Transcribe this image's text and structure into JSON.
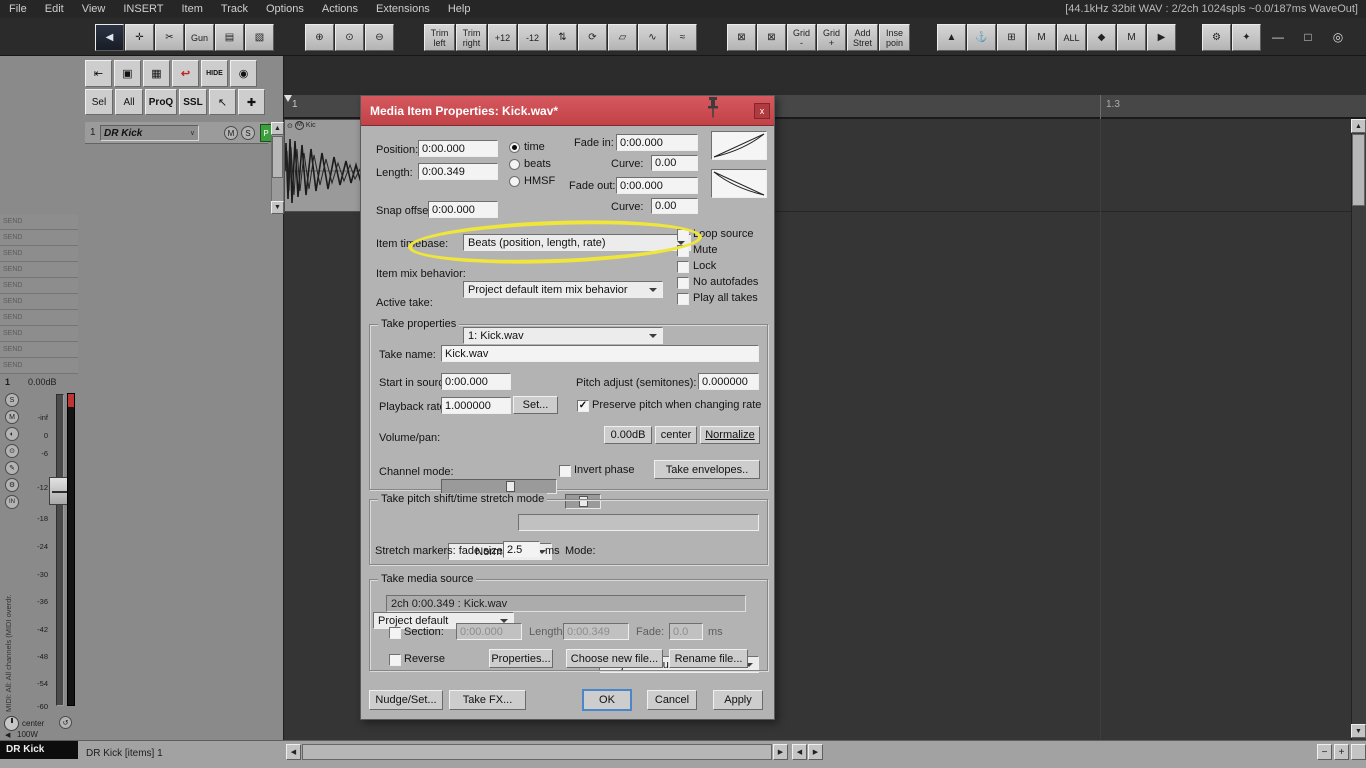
{
  "window": {
    "menu_items": [
      "File",
      "Edit",
      "View",
      "INSERT",
      "Item",
      "Track",
      "Options",
      "Actions",
      "Extensions",
      "Help"
    ],
    "audio_status": "[44.1kHz 32bit WAV : 2/2ch 1024spls ~0.0/187ms WaveOut]",
    "minimize": "—",
    "maximize": "□",
    "power": "◎"
  },
  "toolbar": {
    "g1": [
      "◀",
      "✛",
      "✂",
      "Gun",
      "▤",
      "▧"
    ],
    "g2": [
      "⊕",
      "⊙",
      "⊖"
    ],
    "g3": [
      "Trim\nleft",
      "Trim\nright",
      "+12",
      "-12",
      "⇅",
      "⟳",
      "▱",
      "∿",
      "≈"
    ],
    "g4": [
      "⊠",
      "⊠",
      "Grid\n-",
      "Grid\n+",
      "Add\nStret",
      "Inse\npoin"
    ],
    "g5": [
      "▲",
      "⚓",
      "⊞",
      "M",
      "ALL",
      "◆",
      "M",
      "▶"
    ],
    "g6": [
      "⚙",
      "✦"
    ]
  },
  "left_toolbar": {
    "row1": [
      "⇤",
      "▣",
      "▦",
      "↩",
      "HIDE",
      "◉"
    ],
    "row2": [
      "Sel",
      "All",
      "ProQ",
      "SSL",
      "↖",
      "✚"
    ]
  },
  "track": {
    "number": "1",
    "name": "DR Kick",
    "mute": "M",
    "solo": "S",
    "rec": "P"
  },
  "sends": [
    "SEND",
    "SEND",
    "SEND",
    "SEND",
    "SEND",
    "SEND",
    "SEND",
    "SEND",
    "SEND",
    "SEND"
  ],
  "mixer": {
    "number": "1",
    "volume": "0.00dB",
    "scale": [
      "-inf",
      "0",
      "-6",
      "-12",
      "-18",
      "-24",
      "-30",
      "-36",
      "-42",
      "-48",
      "-54",
      "-60"
    ],
    "side_buttons": [
      "S",
      "M",
      "◐",
      "⊙",
      "✎",
      "⚙",
      "IN"
    ],
    "vertical_label": "MIDI: All: All channels (MIDI overdr.",
    "pan": "center",
    "width": "100W",
    "label": "DR Kick"
  },
  "timeline": {
    "bar_start": "1",
    "bar_mid": "1.3",
    "item_label": "Kic"
  },
  "status": {
    "info": "DR Kick [items] 1"
  },
  "dialog": {
    "title": "Media Item Properties:  Kick.wav*",
    "close": "x",
    "position_label": "Position:",
    "position": "0:00.000",
    "length_label": "Length:",
    "length": "0:00.349",
    "fmt_time": "time",
    "fmt_beats": "beats",
    "fmt_hmsf": "HMSF",
    "fmt": {
      "time": true,
      "beats": false,
      "hmsf": false
    },
    "fade_in_label": "Fade in:",
    "fade_in": "0:00.000",
    "curve_label": "Curve:",
    "curve_in": "0.00",
    "fade_out_label": "Fade out:",
    "fade_out": "0:00.000",
    "curve_out": "0.00",
    "snap_label": "Snap offset:",
    "snap": "0:00.000",
    "timebase_label": "Item timebase:",
    "timebase": "Beats (position, length, rate)",
    "mix_label": "Item mix behavior:",
    "mix": "Project default item mix behavior",
    "take_label": "Active take:",
    "take": "1: Kick.wav",
    "loop_source": "Loop source",
    "mute": "Mute",
    "lock": "Lock",
    "no_autofades": "No autofades",
    "play_all_takes": "Play all takes",
    "checks": {
      "loop_source": false,
      "mute": false,
      "lock": false,
      "no_autofades": false,
      "play_all_takes": false,
      "preserve": true,
      "invert": false,
      "section": false,
      "reverse": false
    },
    "tp": {
      "group": "Take properties",
      "take_name_label": "Take name:",
      "take_name": "Kick.wav",
      "start_label": "Start in source:",
      "start": "0:00.000",
      "pitch_label": "Pitch adjust (semitones):",
      "pitch": "0.000000",
      "rate_label": "Playback rate:",
      "rate": "1.000000",
      "set": "Set...",
      "preserve": "Preserve pitch when changing rate",
      "volpan_label": "Volume/pan:",
      "db": "0.00dB",
      "pan": "center",
      "normalize": "Normalize",
      "chan_label": "Channel mode:",
      "chan": "Normal",
      "invert": "Invert phase",
      "envelopes": "Take envelopes.."
    },
    "ps": {
      "group": "Take pitch shift/time stretch mode",
      "mode": "Project default",
      "stretch_label": "Stretch markers: fade size:",
      "fade_size": "2.5",
      "ms": "ms",
      "mode_label": "Mode:",
      "stretch_mode": "Project default"
    },
    "ms": {
      "group": "Take media source",
      "source": "2ch 0:00.349 : Kick.wav",
      "section": "Section:",
      "sec_start": "0:00.000",
      "len_label": "Length:",
      "sec_len": "0:00.349",
      "fade_label": "Fade:",
      "sec_fade": "0.0",
      "ms": "ms",
      "reverse": "Reverse",
      "properties": "Properties...",
      "choose": "Choose new file...",
      "rename": "Rename file..."
    },
    "footer": {
      "nudge": "Nudge/Set...",
      "takefx": "Take FX...",
      "ok": "OK",
      "cancel": "Cancel",
      "apply": "Apply"
    }
  }
}
